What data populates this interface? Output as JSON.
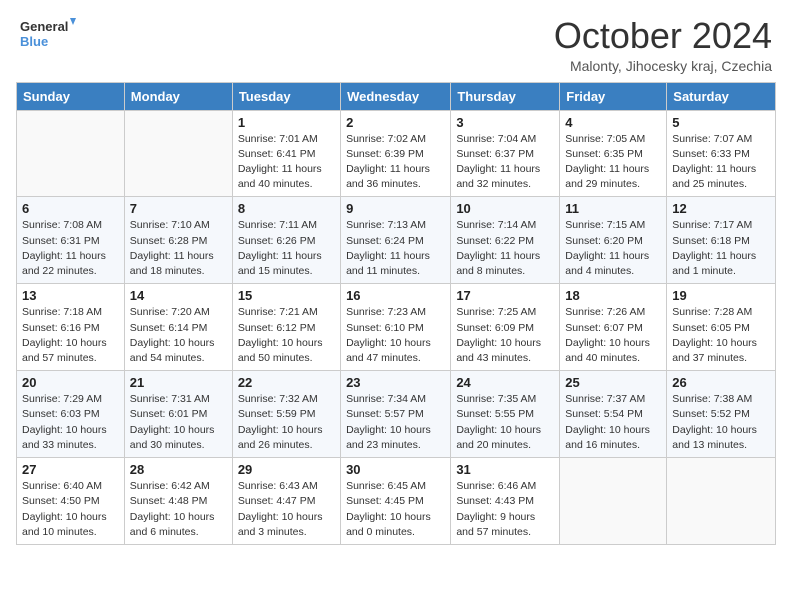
{
  "logo": {
    "line1": "General",
    "line2": "Blue"
  },
  "title": "October 2024",
  "subtitle": "Malonty, Jihocesky kraj, Czechia",
  "days_header": [
    "Sunday",
    "Monday",
    "Tuesday",
    "Wednesday",
    "Thursday",
    "Friday",
    "Saturday"
  ],
  "weeks": [
    [
      {
        "day": "",
        "info": ""
      },
      {
        "day": "",
        "info": ""
      },
      {
        "day": "1",
        "info": "Sunrise: 7:01 AM\nSunset: 6:41 PM\nDaylight: 11 hours and 40 minutes."
      },
      {
        "day": "2",
        "info": "Sunrise: 7:02 AM\nSunset: 6:39 PM\nDaylight: 11 hours and 36 minutes."
      },
      {
        "day": "3",
        "info": "Sunrise: 7:04 AM\nSunset: 6:37 PM\nDaylight: 11 hours and 32 minutes."
      },
      {
        "day": "4",
        "info": "Sunrise: 7:05 AM\nSunset: 6:35 PM\nDaylight: 11 hours and 29 minutes."
      },
      {
        "day": "5",
        "info": "Sunrise: 7:07 AM\nSunset: 6:33 PM\nDaylight: 11 hours and 25 minutes."
      }
    ],
    [
      {
        "day": "6",
        "info": "Sunrise: 7:08 AM\nSunset: 6:31 PM\nDaylight: 11 hours and 22 minutes."
      },
      {
        "day": "7",
        "info": "Sunrise: 7:10 AM\nSunset: 6:28 PM\nDaylight: 11 hours and 18 minutes."
      },
      {
        "day": "8",
        "info": "Sunrise: 7:11 AM\nSunset: 6:26 PM\nDaylight: 11 hours and 15 minutes."
      },
      {
        "day": "9",
        "info": "Sunrise: 7:13 AM\nSunset: 6:24 PM\nDaylight: 11 hours and 11 minutes."
      },
      {
        "day": "10",
        "info": "Sunrise: 7:14 AM\nSunset: 6:22 PM\nDaylight: 11 hours and 8 minutes."
      },
      {
        "day": "11",
        "info": "Sunrise: 7:15 AM\nSunset: 6:20 PM\nDaylight: 11 hours and 4 minutes."
      },
      {
        "day": "12",
        "info": "Sunrise: 7:17 AM\nSunset: 6:18 PM\nDaylight: 11 hours and 1 minute."
      }
    ],
    [
      {
        "day": "13",
        "info": "Sunrise: 7:18 AM\nSunset: 6:16 PM\nDaylight: 10 hours and 57 minutes."
      },
      {
        "day": "14",
        "info": "Sunrise: 7:20 AM\nSunset: 6:14 PM\nDaylight: 10 hours and 54 minutes."
      },
      {
        "day": "15",
        "info": "Sunrise: 7:21 AM\nSunset: 6:12 PM\nDaylight: 10 hours and 50 minutes."
      },
      {
        "day": "16",
        "info": "Sunrise: 7:23 AM\nSunset: 6:10 PM\nDaylight: 10 hours and 47 minutes."
      },
      {
        "day": "17",
        "info": "Sunrise: 7:25 AM\nSunset: 6:09 PM\nDaylight: 10 hours and 43 minutes."
      },
      {
        "day": "18",
        "info": "Sunrise: 7:26 AM\nSunset: 6:07 PM\nDaylight: 10 hours and 40 minutes."
      },
      {
        "day": "19",
        "info": "Sunrise: 7:28 AM\nSunset: 6:05 PM\nDaylight: 10 hours and 37 minutes."
      }
    ],
    [
      {
        "day": "20",
        "info": "Sunrise: 7:29 AM\nSunset: 6:03 PM\nDaylight: 10 hours and 33 minutes."
      },
      {
        "day": "21",
        "info": "Sunrise: 7:31 AM\nSunset: 6:01 PM\nDaylight: 10 hours and 30 minutes."
      },
      {
        "day": "22",
        "info": "Sunrise: 7:32 AM\nSunset: 5:59 PM\nDaylight: 10 hours and 26 minutes."
      },
      {
        "day": "23",
        "info": "Sunrise: 7:34 AM\nSunset: 5:57 PM\nDaylight: 10 hours and 23 minutes."
      },
      {
        "day": "24",
        "info": "Sunrise: 7:35 AM\nSunset: 5:55 PM\nDaylight: 10 hours and 20 minutes."
      },
      {
        "day": "25",
        "info": "Sunrise: 7:37 AM\nSunset: 5:54 PM\nDaylight: 10 hours and 16 minutes."
      },
      {
        "day": "26",
        "info": "Sunrise: 7:38 AM\nSunset: 5:52 PM\nDaylight: 10 hours and 13 minutes."
      }
    ],
    [
      {
        "day": "27",
        "info": "Sunrise: 6:40 AM\nSunset: 4:50 PM\nDaylight: 10 hours and 10 minutes."
      },
      {
        "day": "28",
        "info": "Sunrise: 6:42 AM\nSunset: 4:48 PM\nDaylight: 10 hours and 6 minutes."
      },
      {
        "day": "29",
        "info": "Sunrise: 6:43 AM\nSunset: 4:47 PM\nDaylight: 10 hours and 3 minutes."
      },
      {
        "day": "30",
        "info": "Sunrise: 6:45 AM\nSunset: 4:45 PM\nDaylight: 10 hours and 0 minutes."
      },
      {
        "day": "31",
        "info": "Sunrise: 6:46 AM\nSunset: 4:43 PM\nDaylight: 9 hours and 57 minutes."
      },
      {
        "day": "",
        "info": ""
      },
      {
        "day": "",
        "info": ""
      }
    ]
  ]
}
